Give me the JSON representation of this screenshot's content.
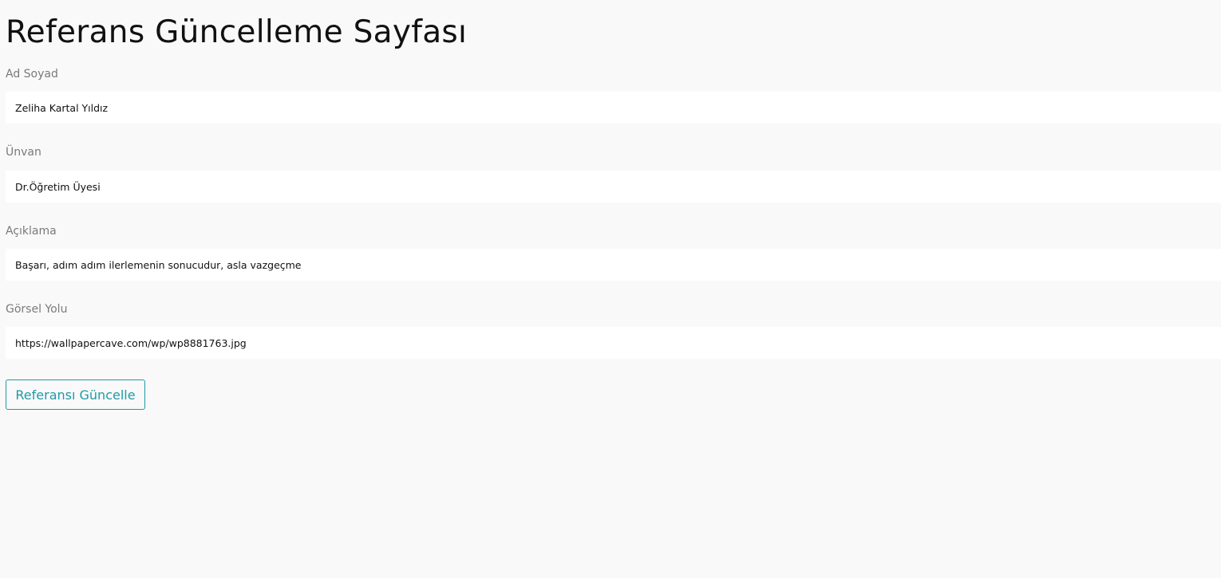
{
  "page": {
    "title": "Referans Güncelleme Sayfası"
  },
  "form": {
    "fields": [
      {
        "label": "Ad Soyad",
        "value": "Zeliha Kartal Yıldız"
      },
      {
        "label": "Ünvan",
        "value": "Dr.Öğretim Üyesi"
      },
      {
        "label": "Açıklama",
        "value": "Başarı, adım adım ilerlemenin sonucudur, asla vazgeçme"
      },
      {
        "label": "Görsel Yolu",
        "value": "https://wallpapercave.com/wp/wp8881763.jpg"
      }
    ],
    "submit_label": "Referansı Güncelle"
  },
  "colors": {
    "background": "#f9f9f9",
    "input_background": "#ffffff",
    "label": "#7a7a7a",
    "accent": "#1f9aa8"
  }
}
